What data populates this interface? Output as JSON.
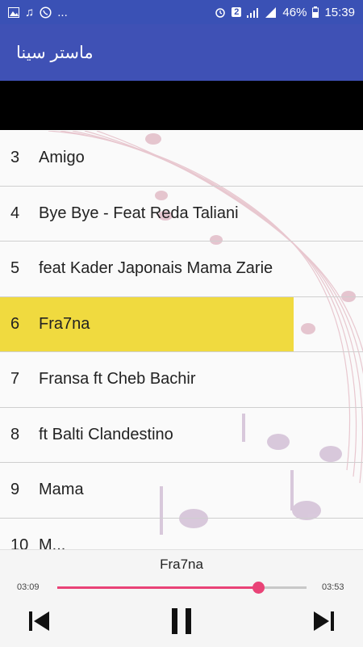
{
  "status_bar": {
    "left_icons": [
      "image-icon",
      "music-note-icon",
      "whatsapp-icon"
    ],
    "left_more": "...",
    "sim_badge": "2",
    "battery": "46%",
    "time": "15:39"
  },
  "app_bar": {
    "title": "ماستر سينا"
  },
  "tracks": [
    {
      "num": "3",
      "title": "Amigo"
    },
    {
      "num": "4",
      "title": "Bye Bye - Feat Reda Taliani"
    },
    {
      "num": "5",
      "title": "feat Kader Japonais Mama Zarie"
    },
    {
      "num": "6",
      "title": "Fra7na",
      "selected": true
    },
    {
      "num": "7",
      "title": "Fransa ft Cheb Bachir"
    },
    {
      "num": "8",
      "title": "ft Balti Clandestino"
    },
    {
      "num": "9",
      "title": "Mama"
    },
    {
      "num": "10",
      "title": "M..."
    }
  ],
  "player": {
    "now_playing": "Fra7na",
    "current_time": "03:09",
    "total_time": "03:53",
    "progress": 0.805,
    "accent": "#e94377",
    "controls": [
      "previous-icon",
      "pause-icon",
      "next-icon"
    ]
  },
  "colors": {
    "app_bar": "#3f51b5",
    "highlight": "#f0da3f"
  }
}
